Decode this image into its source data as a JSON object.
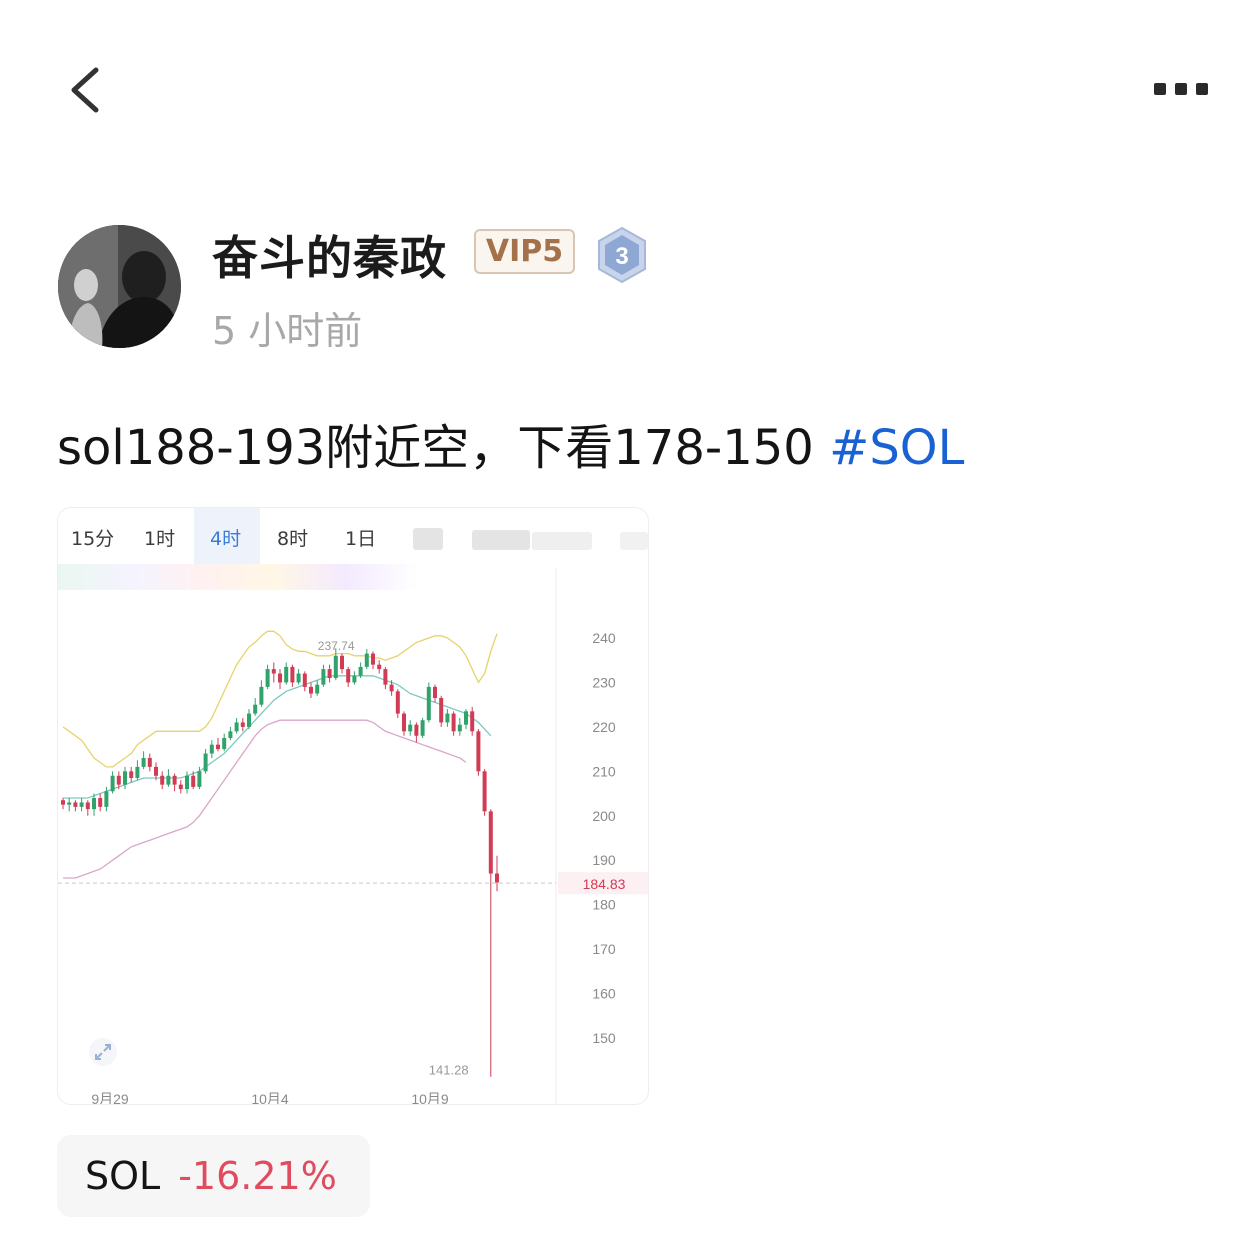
{
  "nav": {
    "back_icon": "chevron-left-icon",
    "more_icon": "more-horizontal-icon"
  },
  "author": {
    "name": "奋斗的秦政",
    "vip_badge": "VIP5",
    "level": "3",
    "time": "5 小时前"
  },
  "post": {
    "text": "sol188-193附近空，下看178-150",
    "hashtag": "#SOL"
  },
  "chart": {
    "timeframes": [
      "15分",
      "1时",
      "4时",
      "8时",
      "1日"
    ],
    "active_timeframe": "4时",
    "current_price_label": "184.83",
    "low_label": "141.28",
    "high_label": "237.74",
    "expand_icon": "expand-icon"
  },
  "chart_data": {
    "type": "candlestick",
    "y_axis_ticks": [
      240,
      230,
      220,
      210,
      200,
      190,
      180,
      170,
      160,
      150
    ],
    "x_axis_ticks": [
      "9月29",
      "10月4",
      "10月9"
    ],
    "ylim": [
      138,
      252
    ],
    "current_price": 184.83,
    "high_marker": 237.74,
    "low_marker": 141.28,
    "candles": [
      [
        203.5,
        202.5,
        204,
        201.5
      ],
      [
        202.5,
        203,
        204,
        201
      ],
      [
        203,
        202,
        203.5,
        201
      ],
      [
        202,
        203,
        204,
        201
      ],
      [
        203,
        201.5,
        203.5,
        200
      ],
      [
        201.5,
        204,
        205,
        200
      ],
      [
        204,
        202,
        205,
        201
      ],
      [
        202,
        205.5,
        206.5,
        201
      ],
      [
        205.5,
        209,
        210,
        205
      ],
      [
        209,
        207,
        210,
        206
      ],
      [
        207,
        210,
        211,
        206
      ],
      [
        210,
        208.5,
        211,
        207.5
      ],
      [
        208.5,
        211,
        212.5,
        208
      ],
      [
        211,
        213,
        214.5,
        210.5
      ],
      [
        213,
        211,
        214,
        210
      ],
      [
        211,
        209,
        212,
        208
      ],
      [
        209,
        207,
        210,
        206
      ],
      [
        207,
        209,
        210.5,
        206.5
      ],
      [
        209,
        207,
        209.5,
        205.5
      ],
      [
        207,
        206,
        208,
        205
      ],
      [
        206,
        209,
        210,
        205
      ],
      [
        209,
        206.5,
        210,
        206
      ],
      [
        206.5,
        210,
        211,
        206
      ],
      [
        210,
        214,
        215,
        209.5
      ],
      [
        214,
        216,
        217,
        213
      ],
      [
        216,
        215,
        217.5,
        214.5
      ],
      [
        215,
        217.5,
        218.5,
        214.5
      ],
      [
        217.5,
        219,
        220,
        217
      ],
      [
        219,
        221,
        222,
        218.5
      ],
      [
        221,
        220,
        222,
        219
      ],
      [
        220,
        223,
        224,
        219.5
      ],
      [
        223,
        225,
        226.5,
        222.5
      ],
      [
        225,
        229,
        230.5,
        224.5
      ],
      [
        229,
        233,
        234,
        228.5
      ],
      [
        233,
        232,
        234.5,
        230
      ],
      [
        232,
        230,
        233,
        228.5
      ],
      [
        230,
        233.5,
        234.5,
        229.5
      ],
      [
        233.5,
        230,
        234,
        229
      ],
      [
        230,
        232,
        233,
        229.5
      ],
      [
        232,
        229,
        232.5,
        228
      ],
      [
        229,
        227.5,
        230,
        226.5
      ],
      [
        227.5,
        229.5,
        230.5,
        227
      ],
      [
        229.5,
        233,
        234,
        229
      ],
      [
        233,
        231,
        234,
        230
      ],
      [
        231,
        236,
        237.7,
        230.5
      ],
      [
        236,
        233,
        236.5,
        232
      ],
      [
        233,
        230,
        233.5,
        229
      ],
      [
        230,
        231.5,
        232.5,
        229.5
      ],
      [
        231.5,
        233.5,
        234.5,
        231
      ],
      [
        233.5,
        236.5,
        237.5,
        233
      ],
      [
        236.5,
        234,
        237,
        233
      ],
      [
        234,
        233,
        235,
        232
      ],
      [
        233,
        229.5,
        233.5,
        228.5
      ],
      [
        229.5,
        228,
        230.5,
        227
      ],
      [
        228,
        223,
        228.5,
        222
      ],
      [
        223,
        219,
        223.5,
        218
      ],
      [
        219,
        220.5,
        221.5,
        218
      ],
      [
        220.5,
        218,
        221,
        216.5
      ],
      [
        218,
        221.5,
        222,
        217.5
      ],
      [
        221.5,
        229,
        230,
        221
      ],
      [
        229,
        226.5,
        229.5,
        225.5
      ],
      [
        226.5,
        221,
        227,
        220
      ],
      [
        221,
        223,
        224,
        220
      ],
      [
        223,
        219,
        223.5,
        218
      ],
      [
        219,
        220.5,
        222,
        218
      ],
      [
        220.5,
        223.5,
        224,
        219.5
      ],
      [
        223.5,
        219,
        224.5,
        218
      ],
      [
        219,
        210,
        219.5,
        209
      ],
      [
        210,
        201,
        210.5,
        200
      ],
      [
        201,
        187,
        201.5,
        141.28
      ],
      [
        187,
        185,
        191,
        183
      ]
    ],
    "upper_band": [
      220,
      219,
      218,
      217,
      215,
      213,
      212,
      211,
      211,
      212,
      213,
      214,
      216,
      217,
      218,
      219,
      219,
      219,
      219,
      219,
      219,
      219,
      219,
      220,
      222,
      225,
      228,
      231,
      234,
      236,
      238,
      239,
      240.5,
      241.5,
      241.5,
      240.5,
      238.5,
      237.5,
      237,
      237,
      236.5,
      236,
      236,
      236,
      236.5,
      236.5,
      236.5,
      236,
      236,
      236,
      235.5,
      235.5,
      235,
      235.5,
      236,
      237,
      238,
      239,
      239.5,
      240,
      240.5,
      240.5,
      240,
      239,
      238,
      236,
      233,
      230,
      232,
      237,
      241
    ],
    "middle_band": [
      204,
      204,
      204,
      204,
      204,
      204.5,
      205,
      205.5,
      206,
      206.5,
      207,
      207.5,
      208,
      208.5,
      208.5,
      208.5,
      208.5,
      208.5,
      208.5,
      208.5,
      209,
      209.5,
      210,
      211,
      212,
      213,
      214,
      215.5,
      217,
      218.5,
      220,
      221.5,
      223,
      224.5,
      226,
      227,
      228,
      228.5,
      229,
      229.5,
      230,
      230.5,
      231,
      231.5,
      231.5,
      231.5,
      231.5,
      231.5,
      231.5,
      231.5,
      231.5,
      231,
      230.5,
      230,
      229.5,
      228.5,
      227.5,
      227,
      226.5,
      226,
      225.5,
      225,
      224.5,
      224,
      223.5,
      223,
      222,
      221,
      219.5,
      218
    ],
    "lower_band": [
      186,
      186,
      186,
      186.5,
      187,
      187.5,
      188,
      189,
      190,
      191,
      192,
      193,
      193.5,
      194,
      194.5,
      195,
      195.5,
      196,
      196.5,
      197,
      197.5,
      198.5,
      200,
      202,
      204,
      206,
      208,
      210,
      212,
      214,
      216,
      218,
      219.5,
      220.5,
      221,
      221.5,
      221.5,
      221.5,
      221.5,
      221.5,
      221.5,
      221.5,
      221.5,
      221.5,
      221.5,
      221.5,
      221.5,
      221.5,
      221.5,
      221.5,
      221,
      220,
      219,
      218.5,
      218,
      217.5,
      217,
      216.5,
      216,
      215.5,
      215,
      214.5,
      214,
      213.5,
      213,
      212
    ]
  },
  "ticker": {
    "symbol": "SOL",
    "change": "-16.21%"
  },
  "colors": {
    "up": "#30a36b",
    "down": "#d13b54",
    "upper_band": "#e6d36a",
    "middle_band": "#7dc9c0",
    "lower_band": "#d9a6c8",
    "hashtag": "#1a62d4"
  }
}
